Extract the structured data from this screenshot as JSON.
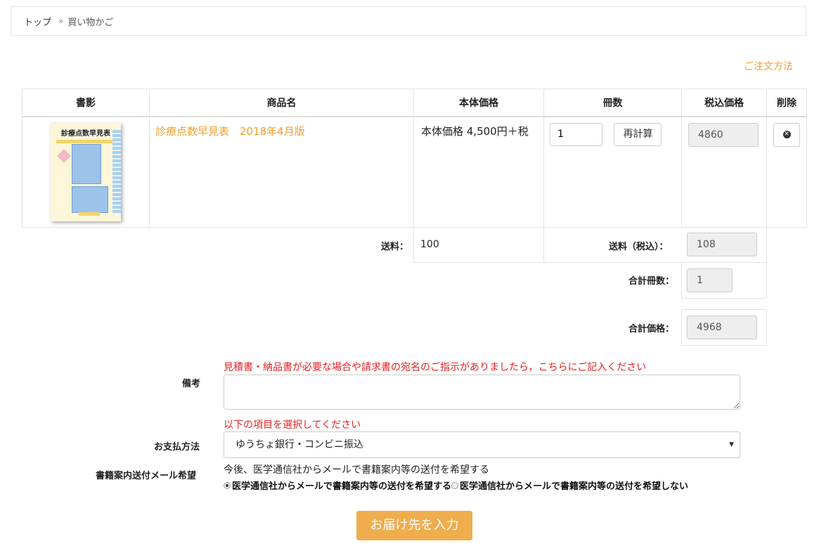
{
  "breadcrumb": {
    "home": "トップ",
    "separator": "»",
    "current": "買い物かご"
  },
  "order_method_link": "ご注文方法",
  "cart": {
    "headers": {
      "image": "書影",
      "name": "商品名",
      "base_price": "本体価格",
      "qty": "冊数",
      "tax_price": "税込価格",
      "delete": "削除"
    },
    "items": [
      {
        "cover_title": "診療点数早見表",
        "name": "診療点数早見表　2018年4月版",
        "base_price": "本体価格 4,500円＋税",
        "qty": "1",
        "recalc_label": "再計算",
        "tax_price": "4860"
      }
    ]
  },
  "summary": {
    "shipping_label": "送料：",
    "shipping_value": "100",
    "shipping_tax_label": "送料（税込）：",
    "shipping_tax_value": "108",
    "total_qty_label": "合計冊数：",
    "total_qty_value": "1",
    "total_price_label": "合計価格：",
    "total_price_value": "4968"
  },
  "form": {
    "remarks_note": "見積書・納品書が必要な場合や請求書の宛名のご指示がありましたら，こちらにご記入ください",
    "remarks_label": "備考",
    "payment_note": "以下の項目を選択してください",
    "payment_label": "お支払方法",
    "payment_selected": "ゆうちょ銀行・コンビニ振込",
    "mail_label": "書籍案内送付メール希望",
    "mail_desc": "今後、医学通信社からメールで書籍案内等の送付を希望する",
    "mail_option_yes": "医学通信社からメールで書籍案内等の送付を希望する",
    "mail_option_no": "医学通信社からメールで書籍案内等の送付を希望しない",
    "submit_label": "お届け先を入力"
  },
  "colors": {
    "accent": "#f0a030",
    "primary_button": "#f0ad4e",
    "warning_text": "#e82020"
  }
}
